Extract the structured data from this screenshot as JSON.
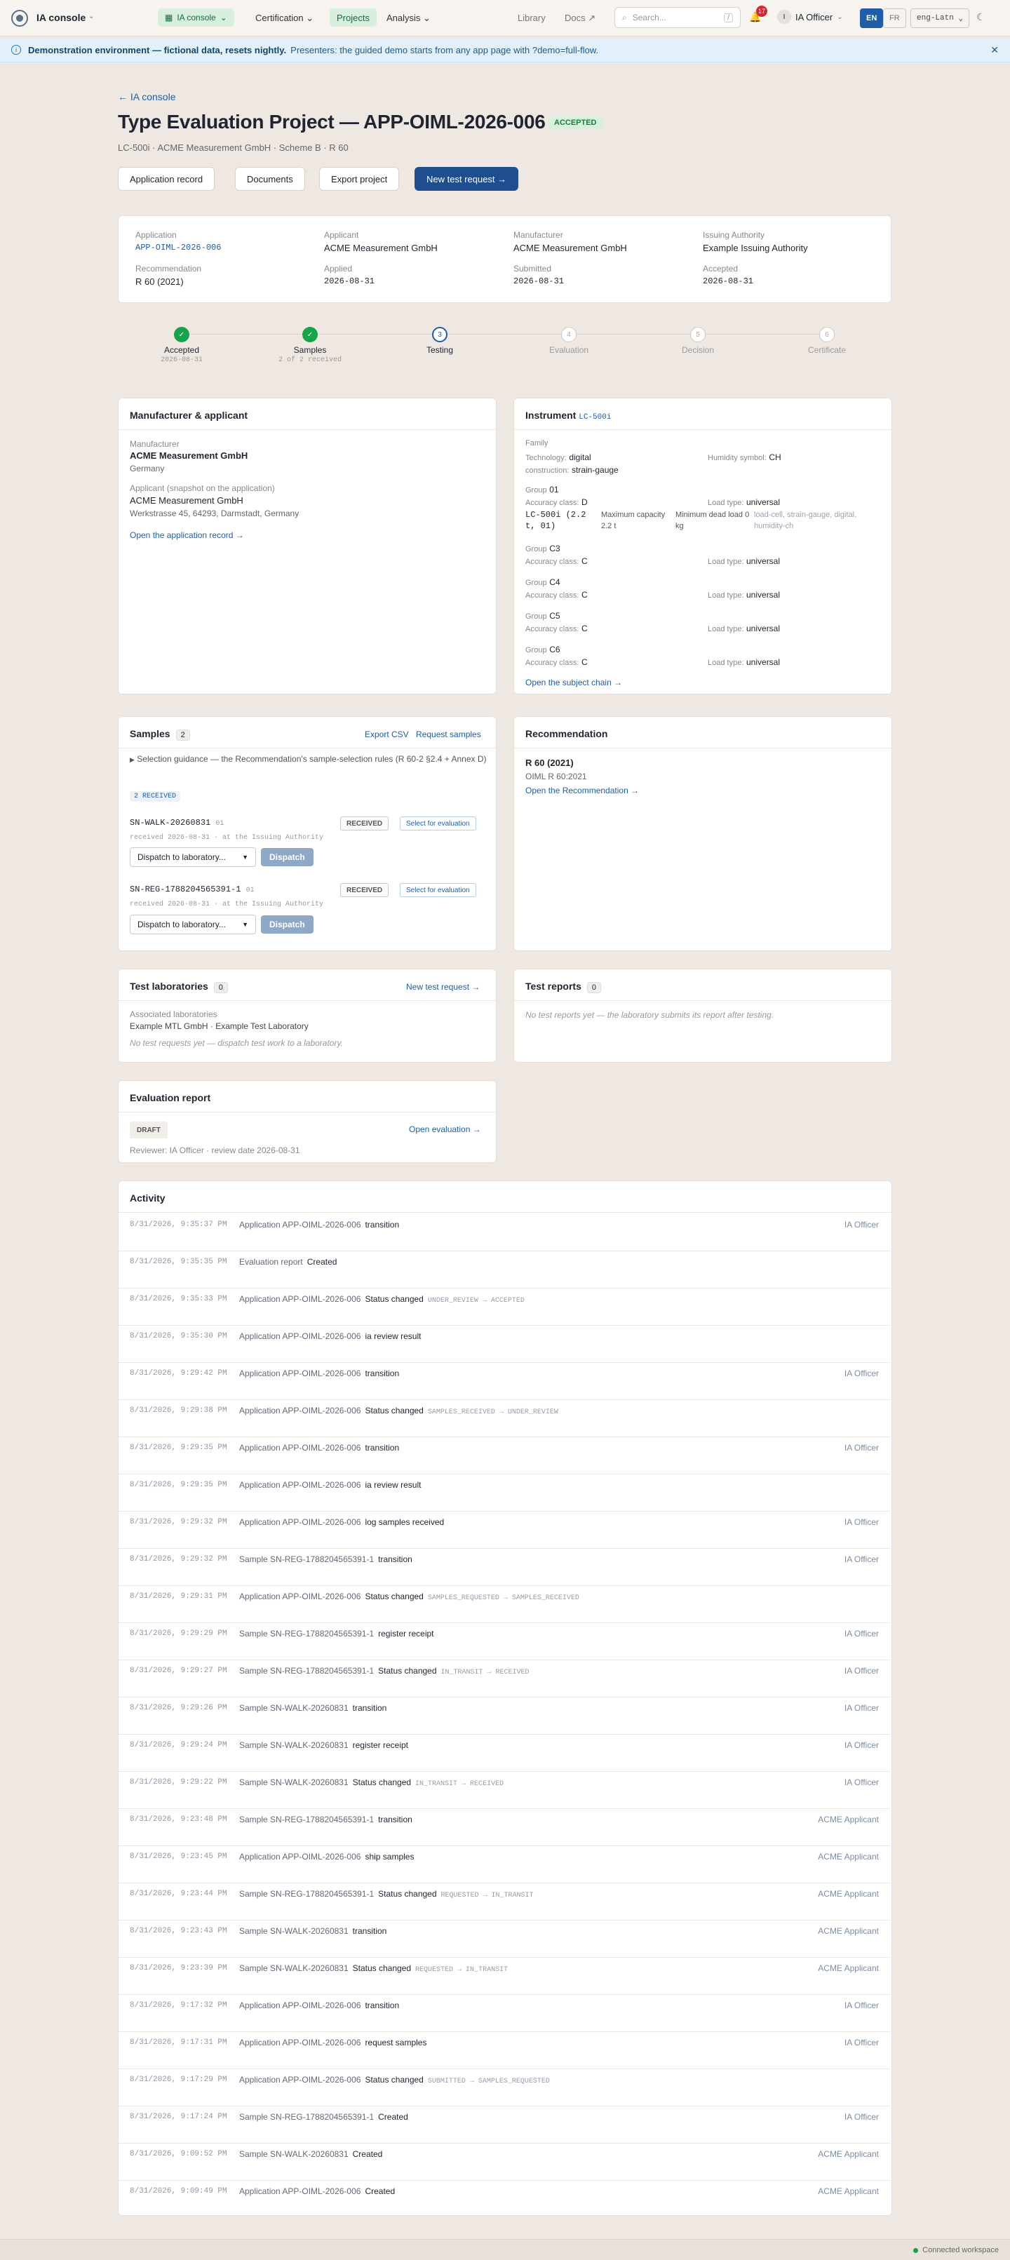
{
  "topbar": {
    "brand": "IA console",
    "nav_pill": "IA console",
    "certification": "Certification",
    "projects": "Projects",
    "analysis": "Analysis",
    "library": "Library",
    "docs": "Docs",
    "search_placeholder": "Search...",
    "search_kbd": "/",
    "notifications": "17",
    "user_initial": "I",
    "user": "IA Officer",
    "lang_en": "EN",
    "lang_fr": "FR",
    "locale": "eng-Latn"
  },
  "banner": {
    "bold": "Demonstration environment — fictional data, resets nightly.",
    "text": "Presenters: the guided demo starts from any app page with ?demo=full-flow."
  },
  "page": {
    "back": "← IA console",
    "title": "Type Evaluation Project — APP-OIML-2026-006",
    "status": "ACCEPTED",
    "subtitle": "LC-500i · ACME Measurement GmbH · Scheme B · R 60"
  },
  "actions": {
    "application_record": "Application record",
    "documents": "Documents",
    "export": "Export project",
    "new_test": "New test request →"
  },
  "summary": {
    "application_label": "Application",
    "application": "APP-OIML-2026-006",
    "applicant_label": "Applicant",
    "applicant": "ACME Measurement GmbH",
    "manufacturer_label": "Manufacturer",
    "manufacturer": "ACME Measurement GmbH",
    "authority_label": "Issuing Authority",
    "authority": "Example Issuing Authority",
    "recommendation_label": "Recommendation",
    "recommendation": "R 60 (2021)",
    "applied_label": "Applied",
    "applied": "2026-08-31",
    "submitted_label": "Submitted",
    "submitted": "2026-08-31",
    "accepted_label": "Accepted",
    "accepted": "2026-08-31"
  },
  "steps": [
    {
      "label": "Accepted",
      "sub": "2026-08-31",
      "state": "done",
      "mark": "✓"
    },
    {
      "label": "Samples",
      "sub": "2 of 2 received",
      "state": "done",
      "mark": "✓"
    },
    {
      "label": "Testing",
      "sub": "",
      "state": "current",
      "mark": "3"
    },
    {
      "label": "Evaluation",
      "sub": "",
      "state": "todo",
      "mark": "4"
    },
    {
      "label": "Decision",
      "sub": "",
      "state": "todo",
      "mark": "5"
    },
    {
      "label": "Certificate",
      "sub": "",
      "state": "todo",
      "mark": "6"
    }
  ],
  "manufacturer_card": {
    "title": "Manufacturer & applicant",
    "m_label": "Manufacturer",
    "m_name": "ACME Measurement GmbH",
    "m_country": "Germany",
    "a_label": "Applicant (snapshot on the application)",
    "a_name": "ACME Measurement GmbH",
    "a_address": "Werkstrasse 45, 64293, Darmstadt, Germany",
    "link": "Open the application record →"
  },
  "instrument": {
    "title": "Instrument",
    "code": "LC-500i",
    "family_label": "Family",
    "tech_label": "Technology:",
    "tech": "digital",
    "hum_label": "Humidity symbol:",
    "hum": "CH",
    "cons_label": "construction:",
    "cons": "strain-gauge",
    "groups": [
      {
        "name": "01",
        "acc": "D",
        "load": "universal",
        "model": "LC-500i (2.2 t, 01)",
        "maxcap_label": "Maximum capacity",
        "maxcap": "2.2 t",
        "mindead_label": "Minimum dead load",
        "mindead": "0 kg",
        "tags": "load-cell, strain-gauge, digital, humidity-ch"
      },
      {
        "name": "C3",
        "acc": "C",
        "load": "universal"
      },
      {
        "name": "C4",
        "acc": "C",
        "load": "universal"
      },
      {
        "name": "C5",
        "acc": "C",
        "load": "universal"
      },
      {
        "name": "C6",
        "acc": "C",
        "load": "universal"
      }
    ],
    "group_label": "Group",
    "acc_label": "Accuracy class:",
    "load_label": "Load type:",
    "link": "Open the subject chain →"
  },
  "samples": {
    "title": "Samples",
    "count": "2",
    "export": "Export CSV",
    "request": "Request samples",
    "guidance": "Selection guidance — the Recommendation's sample-selection rules (R 60-2 §2.4 + Annex D)",
    "received_tag": "2 RECEIVED",
    "items": [
      {
        "id": "SN-WALK-20260831",
        "grp": "01",
        "status": "RECEIVED",
        "select": "Select for evaluation",
        "meta": "received 2026-08-31 · at the Issuing Authority",
        "dispatch_placeholder": "Dispatch to laboratory...",
        "dispatch": "Dispatch"
      },
      {
        "id": "SN-REG-1788204565391-1",
        "grp": "01",
        "status": "RECEIVED",
        "select": "Select for evaluation",
        "meta": "received 2026-08-31 · at the Issuing Authority",
        "dispatch_placeholder": "Dispatch to laboratory...",
        "dispatch": "Dispatch"
      }
    ]
  },
  "recommendation": {
    "title": "Recommendation",
    "name": "R 60 (2021)",
    "sub": "OIML R 60:2021",
    "link": "Open the Recommendation →"
  },
  "labs": {
    "title": "Test laboratories",
    "count": "0",
    "new": "New test request →",
    "assoc_label": "Associated laboratories",
    "assoc": "Example MTL GmbH · Example Test Laboratory",
    "empty": "No test requests yet — dispatch test work to a laboratory."
  },
  "reports": {
    "title": "Test reports",
    "count": "0",
    "empty": "No test reports yet — the laboratory submits its report after testing."
  },
  "evaluation": {
    "title": "Evaluation report",
    "status": "DRAFT",
    "open": "Open evaluation →",
    "meta": "Reviewer: IA Officer · review date 2026-08-31"
  },
  "activity": {
    "title": "Activity",
    "rows": [
      {
        "time": "8/31/2026, 9:35:37 PM",
        "subj": "Application APP-OIML-2026-006",
        "verb": "transition",
        "tr": "",
        "who": "IA Officer"
      },
      {
        "time": "8/31/2026, 9:35:35 PM",
        "subj": "Evaluation report",
        "verb": "Created",
        "tr": "",
        "who": ""
      },
      {
        "time": "8/31/2026, 9:35:33 PM",
        "subj": "Application APP-OIML-2026-006",
        "verb": "Status changed",
        "tr": "UNDER_REVIEW → ACCEPTED",
        "who": ""
      },
      {
        "time": "8/31/2026, 9:35:30 PM",
        "subj": "Application APP-OIML-2026-006",
        "verb": "ia review result",
        "tr": "",
        "who": ""
      },
      {
        "time": "8/31/2026, 9:29:42 PM",
        "subj": "Application APP-OIML-2026-006",
        "verb": "transition",
        "tr": "",
        "who": "IA Officer"
      },
      {
        "time": "8/31/2026, 9:29:38 PM",
        "subj": "Application APP-OIML-2026-006",
        "verb": "Status changed",
        "tr": "SAMPLES_RECEIVED → UNDER_REVIEW",
        "who": ""
      },
      {
        "time": "8/31/2026, 9:29:35 PM",
        "subj": "Application APP-OIML-2026-006",
        "verb": "transition",
        "tr": "",
        "who": "IA Officer"
      },
      {
        "time": "8/31/2026, 9:29:35 PM",
        "subj": "Application APP-OIML-2026-006",
        "verb": "ia review result",
        "tr": "",
        "who": ""
      },
      {
        "time": "8/31/2026, 9:29:32 PM",
        "subj": "Application APP-OIML-2026-006",
        "verb": "log samples received",
        "tr": "",
        "who": "IA Officer"
      },
      {
        "time": "8/31/2026, 9:29:32 PM",
        "subj": "Sample SN-REG-1788204565391-1",
        "verb": "transition",
        "tr": "",
        "who": "IA Officer"
      },
      {
        "time": "8/31/2026, 9:29:31 PM",
        "subj": "Application APP-OIML-2026-006",
        "verb": "Status changed",
        "tr": "SAMPLES_REQUESTED → SAMPLES_RECEIVED",
        "who": ""
      },
      {
        "time": "8/31/2026, 9:29:29 PM",
        "subj": "Sample SN-REG-1788204565391-1",
        "verb": "register receipt",
        "tr": "",
        "who": "IA Officer"
      },
      {
        "time": "8/31/2026, 9:29:27 PM",
        "subj": "Sample SN-REG-1788204565391-1",
        "verb": "Status changed",
        "tr": "IN_TRANSIT → RECEIVED",
        "who": "IA Officer"
      },
      {
        "time": "8/31/2026, 9:29:26 PM",
        "subj": "Sample SN-WALK-20260831",
        "verb": "transition",
        "tr": "",
        "who": "IA Officer"
      },
      {
        "time": "8/31/2026, 9:29:24 PM",
        "subj": "Sample SN-WALK-20260831",
        "verb": "register receipt",
        "tr": "",
        "who": "IA Officer"
      },
      {
        "time": "8/31/2026, 9:29:22 PM",
        "subj": "Sample SN-WALK-20260831",
        "verb": "Status changed",
        "tr": "IN_TRANSIT → RECEIVED",
        "who": "IA Officer"
      },
      {
        "time": "8/31/2026, 9:23:48 PM",
        "subj": "Sample SN-REG-1788204565391-1",
        "verb": "transition",
        "tr": "",
        "who": "ACME Applicant"
      },
      {
        "time": "8/31/2026, 9:23:45 PM",
        "subj": "Application APP-OIML-2026-006",
        "verb": "ship samples",
        "tr": "",
        "who": "ACME Applicant"
      },
      {
        "time": "8/31/2026, 9:23:44 PM",
        "subj": "Sample SN-REG-1788204565391-1",
        "verb": "Status changed",
        "tr": "REQUESTED → IN_TRANSIT",
        "who": "ACME Applicant"
      },
      {
        "time": "8/31/2026, 9:23:43 PM",
        "subj": "Sample SN-WALK-20260831",
        "verb": "transition",
        "tr": "",
        "who": "ACME Applicant"
      },
      {
        "time": "8/31/2026, 9:23:39 PM",
        "subj": "Sample SN-WALK-20260831",
        "verb": "Status changed",
        "tr": "REQUESTED → IN_TRANSIT",
        "who": "ACME Applicant"
      },
      {
        "time": "8/31/2026, 9:17:32 PM",
        "subj": "Application APP-OIML-2026-006",
        "verb": "transition",
        "tr": "",
        "who": "IA Officer"
      },
      {
        "time": "8/31/2026, 9:17:31 PM",
        "subj": "Application APP-OIML-2026-006",
        "verb": "request samples",
        "tr": "",
        "who": "IA Officer"
      },
      {
        "time": "8/31/2026, 9:17:29 PM",
        "subj": "Application APP-OIML-2026-006",
        "verb": "Status changed",
        "tr": "SUBMITTED → SAMPLES_REQUESTED",
        "who": ""
      },
      {
        "time": "8/31/2026, 9:17:24 PM",
        "subj": "Sample SN-REG-1788204565391-1",
        "verb": "Created",
        "tr": "",
        "who": "IA Officer"
      },
      {
        "time": "8/31/2026, 9:09:52 PM",
        "subj": "Sample SN-WALK-20260831",
        "verb": "Created",
        "tr": "",
        "who": "ACME Applicant"
      },
      {
        "time": "8/31/2026, 9:09:49 PM",
        "subj": "Application APP-OIML-2026-006",
        "verb": "Created",
        "tr": "",
        "who": "ACME Applicant"
      }
    ]
  },
  "footer": {
    "status": "Connected workspace"
  }
}
